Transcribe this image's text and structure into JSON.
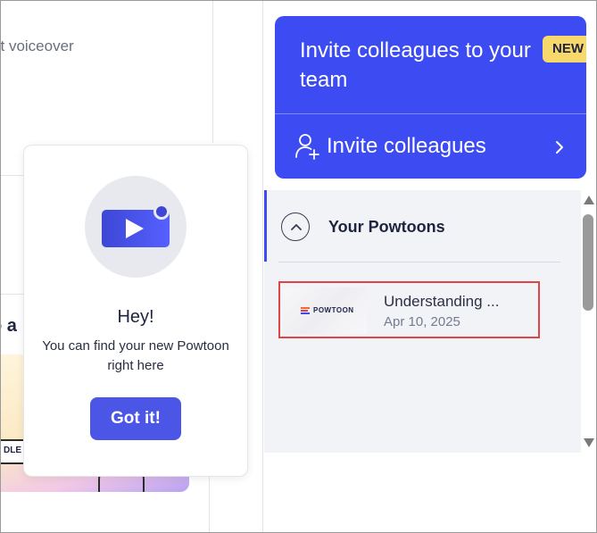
{
  "background": {
    "voiceover_fragment": "ct voiceover",
    "heading_fragment": "o a",
    "sketch_fragment": "DLE"
  },
  "tooltip": {
    "title": "Hey!",
    "message": "You can find your new Powtoon right here",
    "button_label": "Got it!"
  },
  "invite_card": {
    "title": "Invite colleagues to your team",
    "badge": "NEW",
    "action_label": "Invite colleagues",
    "icons": [
      "user-plus-icon",
      "chevron-right-icon"
    ]
  },
  "powtoons_section": {
    "title": "Your Powtoons",
    "icon": "chevron-up-icon",
    "items": [
      {
        "title": "Understanding ...",
        "date": "Apr 10, 2025",
        "thumbnail_logo": "POWTOON"
      }
    ]
  },
  "colors": {
    "primary": "#3d4cf2",
    "button": "#4b55e6",
    "badge": "#f7d86a",
    "highlight_border": "#e04444",
    "panel_bg": "#f2f3f6"
  }
}
